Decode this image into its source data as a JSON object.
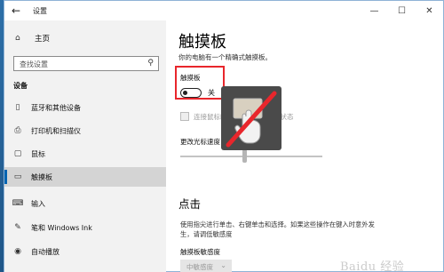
{
  "window": {
    "title": "设置",
    "controls": {
      "minimize": "—",
      "maximize": "☐",
      "close": "✕"
    }
  },
  "sidebar": {
    "home": "主页",
    "search_placeholder": "查找设置",
    "section": "设备",
    "items": [
      {
        "label": "蓝牙和其他设备",
        "icon": "bluetooth-icon"
      },
      {
        "label": "打印机和扫描仪",
        "icon": "printer-icon"
      },
      {
        "label": "鼠标",
        "icon": "mouse-icon"
      },
      {
        "label": "触摸板",
        "icon": "touchpad-icon",
        "active": true
      },
      {
        "label": "输入",
        "icon": "keyboard-icon"
      },
      {
        "label": "笔和 Windows Ink",
        "icon": "pen-icon"
      },
      {
        "label": "自动播放",
        "icon": "autoplay-icon"
      }
    ]
  },
  "main": {
    "title": "触摸板",
    "subtitle": "你的电脑有一个精确式触摸板。",
    "touchpad_label": "触摸板",
    "toggle_state": "关",
    "checkbox_text": "连接鼠标时让触摸板保持打开状态",
    "cursor_speed_label": "更改光标速度",
    "section_title": "点击",
    "description": "使用指尖进行单击、右键单击和选择。如果这些操作在键入时意外发生，请调低敏感度",
    "sensitivity_label": "触摸板敏感度",
    "sensitivity_value": "中敏感度"
  },
  "overlay": {
    "icon": "touchpad-disabled-icon"
  },
  "watermark": "Baidu 经验",
  "colors": {
    "accent": "#0063b1",
    "highlight_box": "#e8262c",
    "sidebar_bg": "#f2f2f2",
    "overlay_bg": "#4a4a4a"
  }
}
